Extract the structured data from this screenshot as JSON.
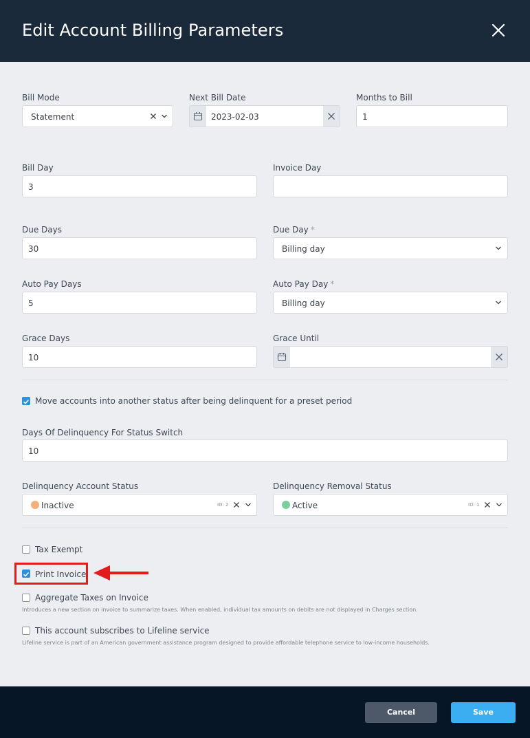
{
  "dialog": {
    "title": "Edit Account Billing Parameters"
  },
  "fields": {
    "bill_mode": {
      "label": "Bill Mode",
      "value": "Statement"
    },
    "next_bill_date": {
      "label": "Next Bill Date",
      "value": "2023-02-03"
    },
    "months_to_bill": {
      "label": "Months to Bill",
      "value": "1"
    },
    "bill_day": {
      "label": "Bill Day",
      "value": "3"
    },
    "invoice_day": {
      "label": "Invoice Day",
      "value": ""
    },
    "due_days": {
      "label": "Due Days",
      "value": "30"
    },
    "due_day": {
      "label": "Due Day",
      "required_mark": "*",
      "value": "Billing day"
    },
    "auto_pay_days": {
      "label": "Auto Pay Days",
      "value": "5"
    },
    "auto_pay_day": {
      "label": "Auto Pay Day",
      "required_mark": "*",
      "value": "Billing day"
    },
    "grace_days": {
      "label": "Grace Days",
      "value": "10"
    },
    "grace_until": {
      "label": "Grace Until",
      "value": ""
    },
    "delinquency_days": {
      "label": "Days Of Delinquency For Status Switch",
      "value": "10"
    },
    "delinquency_account_status": {
      "label": "Delinquency Account Status",
      "value": "Inactive",
      "id_tag": "ID: 2",
      "dot_color": "#f0b27a"
    },
    "delinquency_removal_status": {
      "label": "Delinquency Removal Status",
      "value": "Active",
      "id_tag": "ID: 1",
      "dot_color": "#7dcf9c"
    }
  },
  "checkboxes": {
    "move_delinquent": {
      "label": "Move accounts into another status after being delinquent for a preset period",
      "checked": true
    },
    "tax_exempt": {
      "label": "Tax Exempt",
      "checked": false
    },
    "print_invoice": {
      "label": "Print Invoice",
      "checked": true
    },
    "aggregate_taxes": {
      "label": "Aggregate Taxes on Invoice",
      "checked": false,
      "hint": "Introduces a new section on invoice to summarize taxes. When enabled, individual tax amounts on debits are not displayed in Charges section."
    },
    "lifeline": {
      "label": "This account subscribes to Lifeline service",
      "checked": false,
      "hint": "Lifeline service is part of an American government assistance program designed to provide affordable telephone service to low-income households."
    }
  },
  "footer": {
    "cancel_label": "Cancel",
    "save_label": "Save"
  },
  "colors": {
    "header_bg": "#1b2a3b",
    "footer_bg": "#071626",
    "accent": "#3aaef0",
    "checkbox_on": "#2f8fd8",
    "highlight": "#e11c1c"
  }
}
